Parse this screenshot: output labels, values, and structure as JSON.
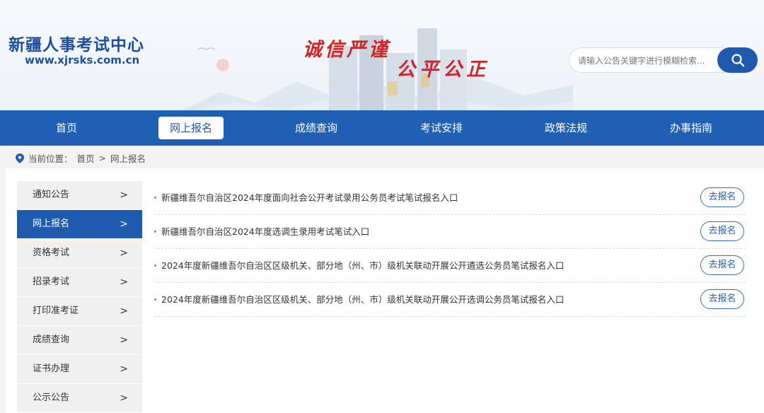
{
  "header": {
    "site_title": "新疆人事考试中心",
    "site_url": "www.xjrsks.com.cn",
    "slogan_line1": "诚信严谨",
    "slogan_line2": "公平公正"
  },
  "search": {
    "placeholder": "请输入公告关键字进行模糊检索...",
    "value": "",
    "icon": "search-icon"
  },
  "nav": {
    "items": [
      {
        "label": "首页",
        "active": false
      },
      {
        "label": "网上报名",
        "active": true
      },
      {
        "label": "成绩查询",
        "active": false
      },
      {
        "label": "考试安排",
        "active": false
      },
      {
        "label": "政策法规",
        "active": false
      },
      {
        "label": "办事指南",
        "active": false
      }
    ]
  },
  "breadcrumb": {
    "icon": "location-pin-icon",
    "prefix": "当前位置：",
    "home": "首页",
    "separator": ">",
    "current": "网上报名"
  },
  "sidebar": {
    "items": [
      {
        "label": "通知公告",
        "active": false
      },
      {
        "label": "网上报名",
        "active": true
      },
      {
        "label": "资格考试",
        "active": false
      },
      {
        "label": "招录考试",
        "active": false
      },
      {
        "label": "打印准考证",
        "active": false
      },
      {
        "label": "成绩查询",
        "active": false
      },
      {
        "label": "证书办理",
        "active": false
      },
      {
        "label": "公示公告",
        "active": false
      }
    ],
    "arrow": ">"
  },
  "list": {
    "items": [
      {
        "title": "新疆维吾尔自治区2024年度面向社会公开考试录用公务员考试笔试报名入口",
        "button": "去报名"
      },
      {
        "title": "新疆维吾尔自治区2024年度选调生录用考试笔试入口",
        "button": "去报名"
      },
      {
        "title": "2024年度新疆维吾尔自治区区级机关、部分地（州、市）级机关联动开展公开遴选公务员笔试报名入口",
        "button": "去报名"
      },
      {
        "title": "2024年度新疆维吾尔自治区区级机关、部分地（州、市）级机关联动开展公开选调公务员笔试报名入口",
        "button": "去报名"
      }
    ]
  },
  "colors": {
    "primary": "#2060b4",
    "slogan": "#d0262a",
    "title": "#1d4f9c"
  }
}
